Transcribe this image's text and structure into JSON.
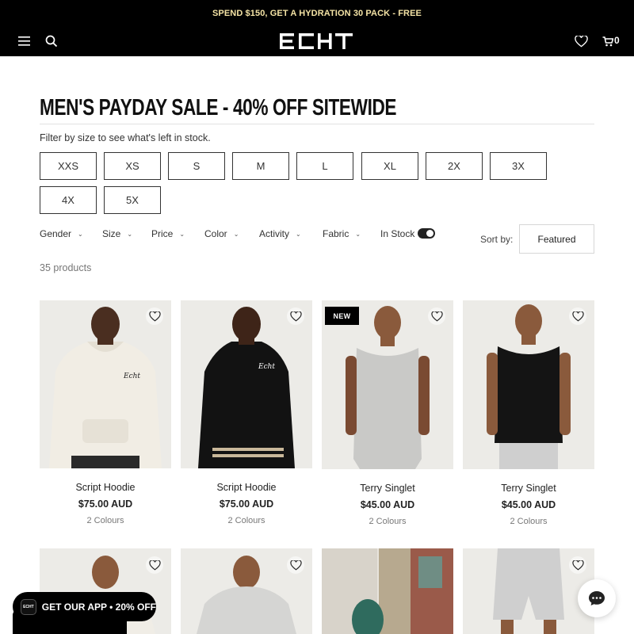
{
  "promo": {
    "text": "SPEND $150, GET A HYDRATION 30 PACK - FREE"
  },
  "header": {
    "logo_text": "ECHT",
    "cart_count": "0",
    "icons": [
      "menu-icon",
      "search-icon",
      "heart-icon",
      "cart-icon"
    ]
  },
  "collection": {
    "title": "MEN'S PAYDAY SALE - 40% OFF SITEWIDE",
    "filter_hint": "Filter by size to see what's left in stock.",
    "sizes": [
      "XXS",
      "XS",
      "S",
      "M",
      "L",
      "XL",
      "2X",
      "3X",
      "4X",
      "5X"
    ],
    "filters": [
      "Gender",
      "Size",
      "Price",
      "Color",
      "Activity",
      "Fabric"
    ],
    "in_stock_label": "In Stock",
    "in_stock_on": true,
    "sort_label": "Sort by:",
    "sort_value": "Featured",
    "product_count": "35 products"
  },
  "products": [
    {
      "name": "Script Hoodie",
      "price": "$75.00 AUD",
      "colours": "2 Colours",
      "garment_color": "#f1ede4"
    },
    {
      "name": "Script Hoodie",
      "price": "$75.00 AUD",
      "colours": "2 Colours",
      "garment_color": "#111111"
    },
    {
      "name": "Terry Singlet",
      "price": "$45.00 AUD",
      "colours": "2 Colours",
      "badge": "NEW",
      "garment_color": "#cfcfcf"
    },
    {
      "name": "Terry Singlet",
      "price": "$45.00 AUD",
      "colours": "2 Colours",
      "garment_color": "#151515"
    }
  ],
  "app_banner": {
    "text": "GET OUR APP • 20% OFF",
    "logo_text": "ECHT"
  },
  "colors": {
    "promo_text": "#f4e3a5",
    "header_bg": "#000000",
    "image_bg": "#eceae6"
  }
}
